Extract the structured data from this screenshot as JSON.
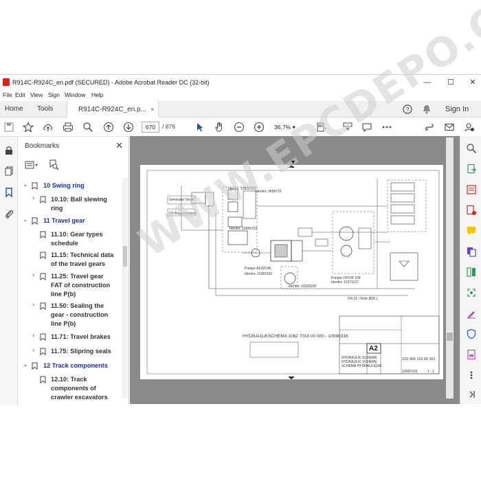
{
  "window": {
    "title": "R914C-R924C_en.pdf (SECURED) - Adobe Acrobat Reader DC (32-bit)",
    "controls": {
      "minimize": "—",
      "maximize": "☐",
      "close": "✕"
    }
  },
  "menu": [
    "File",
    "Edit",
    "View",
    "Sign",
    "Window",
    "Help"
  ],
  "tabs": {
    "home": "Home",
    "tools": "Tools",
    "doc": "R914C-R924C_en.p...",
    "doc_close": "×",
    "sign_in": "Sign In"
  },
  "toolbar": {
    "page_current": "670",
    "page_sep": "/",
    "page_total": "876",
    "zoom": "36,7%"
  },
  "bookmarks": {
    "header": "Bookmarks",
    "close": "✕",
    "items": [
      {
        "label": "10 Swing ring",
        "level": "top",
        "chevron": "⌄"
      },
      {
        "label": "10.10: Ball slewing",
        "label2": "ring",
        "level": "sub",
        "chevron": "›"
      },
      {
        "label": "11 Travel gear",
        "level": "top",
        "chevron": "⌄"
      },
      {
        "label": "11.10: Gear types",
        "label2": "schedule",
        "level": "sub",
        "chevron": ""
      },
      {
        "label": "11.15: Technical data",
        "label2": "of the travel gears",
        "level": "sub",
        "chevron": ""
      },
      {
        "label": "11.25: Travel gear",
        "label2": "FAT of construction",
        "label3": "line P(b)",
        "level": "sub",
        "chevron": "›"
      },
      {
        "label": "11.50: Sealing the",
        "label2": "gear - construction",
        "label3": "line P(b)",
        "level": "sub",
        "chevron": "›"
      },
      {
        "label": "11.71: Travel brakes",
        "level": "sub",
        "chevron": "›"
      },
      {
        "label": "11.75: Slipring seals",
        "level": "sub",
        "chevron": "›"
      },
      {
        "label": "12 Track components",
        "level": "top",
        "chevron": "⌄"
      },
      {
        "label": "12.10: Track",
        "label2": "components of",
        "label3": "crawler excavators",
        "level": "sub",
        "chevron": ""
      }
    ]
  },
  "drawing": {
    "schema_title": "HYDRAULIKSCHEMA 1062 7010 00 000 - 10080316",
    "sheet_code": "A2",
    "drawing_number": "220 966 118 00 301",
    "labels": [
      "Generator Ventil",
      "LH Regelzündung",
      "Identnr. 10625700",
      "Identnr. 9658710",
      "Identnr. 10589722",
      "Pumpe A10VO45",
      "Identnr. 10381932",
      "Pumpe DP16P 168",
      "Identnr. 10171137",
      "DN 32 / Rohr Ø35 L",
      "Identnr. 10326230",
      "HYDRAULIK SCHEMA",
      "HYDRAULIC SCHEME",
      "SCHEMA HYDRAULIQUE",
      "10087015",
      "1 : 1"
    ],
    "watermark": "WWW.EPCDEPO.COM"
  },
  "colors": {
    "accent": "#1a2ea6",
    "acrobat_red": "#d7261e",
    "viewer_bg": "#8a8a8a"
  }
}
